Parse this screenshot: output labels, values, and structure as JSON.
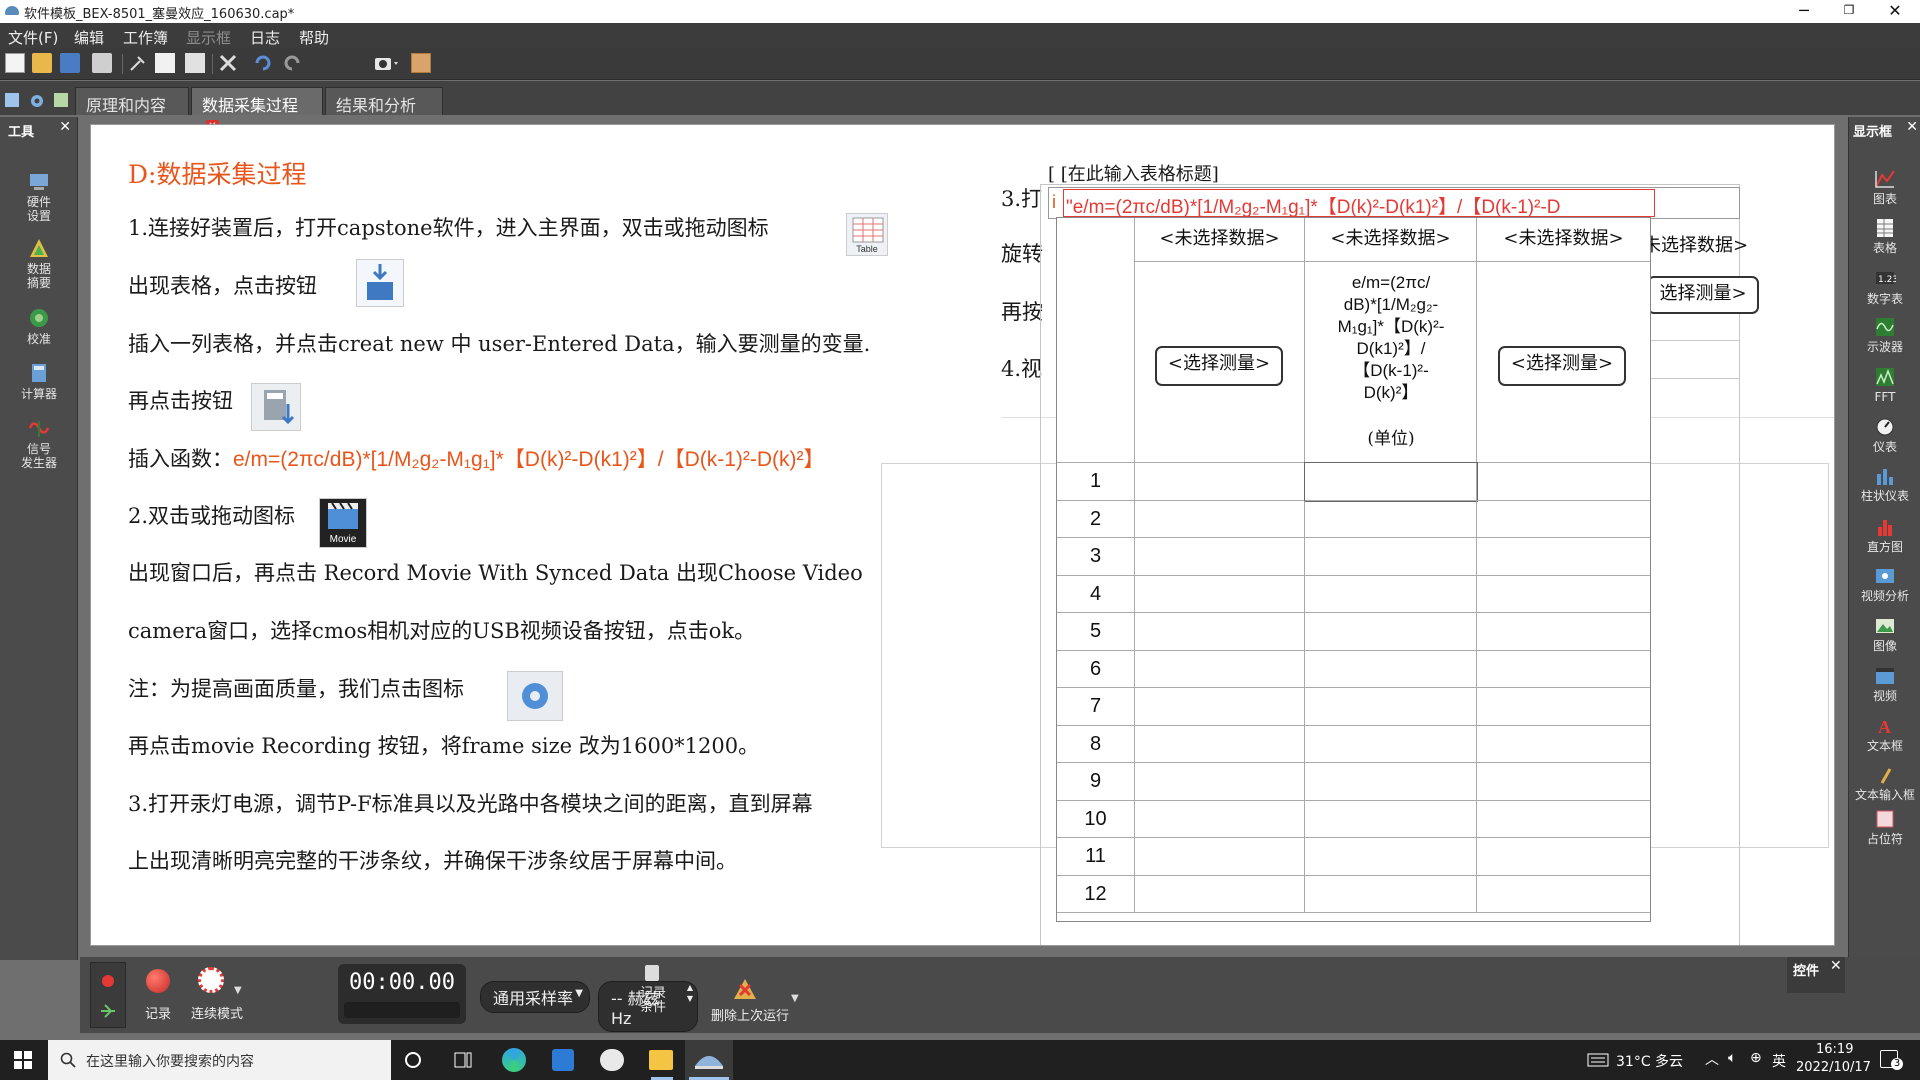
{
  "window": {
    "title": "软件模板_BEX-8501_塞曼效应_160630.cap*"
  },
  "menu": [
    {
      "label": "文件(F)",
      "enabled": true
    },
    {
      "label": "编辑",
      "enabled": true
    },
    {
      "label": "工作簿",
      "enabled": true
    },
    {
      "label": "显示框",
      "enabled": false
    },
    {
      "label": "日志",
      "enabled": true
    },
    {
      "label": "帮助",
      "enabled": true
    }
  ],
  "tabs": [
    {
      "label": "原理和内容"
    },
    {
      "label": "数据采集过程"
    },
    {
      "label": "结果和分析"
    }
  ],
  "left_panel": {
    "title": "工具",
    "tools": [
      {
        "label": "硬件\n设置",
        "icon": "hardware-icon"
      },
      {
        "label": "数据\n摘要",
        "icon": "data-summary-icon"
      },
      {
        "label": "校准",
        "icon": "calibration-icon"
      },
      {
        "label": "计算器",
        "icon": "calculator-icon"
      },
      {
        "label": "信号\n发生器",
        "icon": "signal-generator-icon"
      }
    ]
  },
  "right_panel": {
    "title": "显示框",
    "items": [
      {
        "label": "图表"
      },
      {
        "label": "表格"
      },
      {
        "label": "数字表"
      },
      {
        "label": "示波器"
      },
      {
        "label": "FFT"
      },
      {
        "label": "仪表"
      },
      {
        "label": "柱状仪表"
      },
      {
        "label": "直方图"
      },
      {
        "label": "视频分析"
      },
      {
        "label": "图像"
      },
      {
        "label": "视频"
      },
      {
        "label": "文本框"
      },
      {
        "label": "文本输入框"
      },
      {
        "label": "占位符"
      }
    ]
  },
  "doc": {
    "heading": "D:数据采集过程",
    "line1": "1.连接好装置后，打开capstone软件，进入主界面，双击或拖动图标",
    "table_icon_label": "Table",
    "line2": "出现表格，点击按钮",
    "line3": "插入一列表格，并点击creat new 中 user-Entered Data，输入要测量的变量.",
    "line4": "再点击按钮",
    "line5_prefix": "插入函数：",
    "line5_formula": "e/m=(2πc/dB)*[1/M₂g₂-M₁g₁]*【D(k)²-D(k1)²】/【D(k-1)²-D(k)²】",
    "line6": "2.双击或拖动图标",
    "movie_icon_label": "Movie",
    "line7": "出现窗口后，再点击 Record Movie With Synced Data 出现Choose Video",
    "line8": "camera窗口，选择cmos相机对应的USB视频设备按钮，点击ok。",
    "line9": "注：为提高画面质量，我们点击图标",
    "line10": "再点击movie Recording 按钮，将frame size 改为1600*1200。",
    "line11": "3.打开汞灯电源，调节P-F标准具以及光路中各模块之间的距离，直到屏幕",
    "line12": "上出现清晰明亮完整的干涉条纹，并确保干涉条纹居于屏幕中间。"
  },
  "behind": {
    "l1": "3.打",
    "l2": "旋转",
    "l3": "再按",
    "l4": "4.视",
    "hdr": "未选择数据>",
    "btn": "选择测量>"
  },
  "table": {
    "title": "[ [在此输入表格标题]",
    "formula_input": "\"e/m=(2πc/dB)*[1/M₂g₂-M₁g₁]*【D(k)²-D(k1)²】/【D(k-1)²-D",
    "input_marker": "i",
    "columns": [
      {
        "header": "<未选择数据>",
        "button": "<选择测量>"
      },
      {
        "header": "<未选择数据>",
        "formula": "e/m=(2πc/\ndB)*[1/M₂g₂-\nM₁g₁]*【D(k)²-\nD(k1)²】/\n【D(k-1)²-\nD(k)²】",
        "unit": "(单位)"
      },
      {
        "header": "<未选择数据>",
        "button": "<选择测量>"
      }
    ],
    "rows": [
      "1",
      "2",
      "3",
      "4",
      "5",
      "6",
      "7",
      "8",
      "9",
      "10",
      "11",
      "12"
    ]
  },
  "controls": {
    "record_label": "记录",
    "continuous_label": "连续模式",
    "timer": "00:00.00",
    "sample_rate": "通用采样率",
    "frequency": "-- 赫兹 Hz",
    "record_conditions": "记录\n条件",
    "delete_last": "删除上次运行",
    "controls_panel": "控件"
  },
  "taskbar": {
    "search_placeholder": "在这里输入你要搜索的内容",
    "weather": "31°C 多云",
    "ime": "英",
    "time": "16:19",
    "date": "2022/10/17",
    "notifications": "3"
  },
  "colors": {
    "accent": "#e8561b",
    "red": "#d9312b"
  }
}
